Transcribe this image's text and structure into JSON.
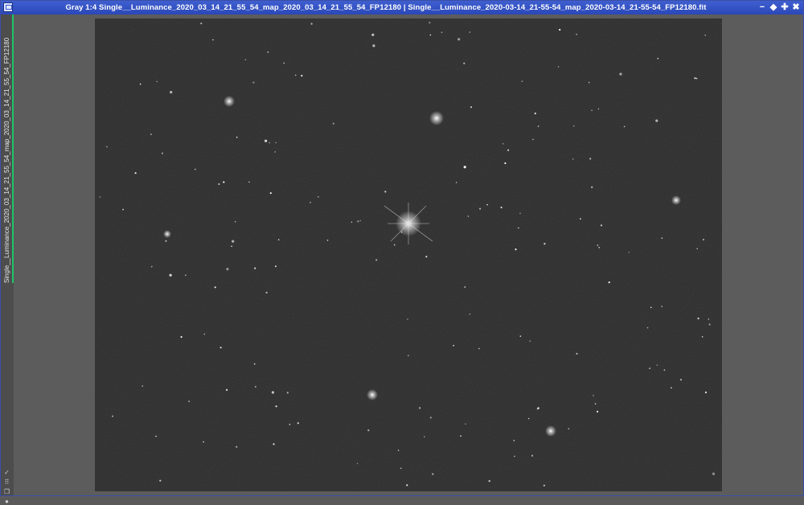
{
  "window": {
    "title": "Gray 1:4 Single__Luminance_2020_03_14_21_55_54_map_2020_03_14_21_55_54_FP12180 | Single__Luminance_2020-03-14_21-55-54_map_2020-03-14_21-55-54_FP12180.fit",
    "buttons": {
      "minimize": "−",
      "shade": "◆",
      "maximize": "✚",
      "close": "✖"
    }
  },
  "sidebar": {
    "tab_label": "Single__Luminance_2020_03_14_21_55_54_map_2020_03_14_21_55_54_FP12180",
    "accent_color": "#1ec46a",
    "tools": [
      {
        "icon": "checkmark-icon",
        "glyph": "✓"
      },
      {
        "icon": "grid-icon",
        "glyph": "⠿"
      },
      {
        "icon": "copy-icon",
        "glyph": "❐"
      },
      {
        "icon": "circle-icon",
        "glyph": "●"
      }
    ]
  },
  "image": {
    "description_colors": {
      "background": "#2c2c2c",
      "stars": "#ffffff"
    }
  }
}
